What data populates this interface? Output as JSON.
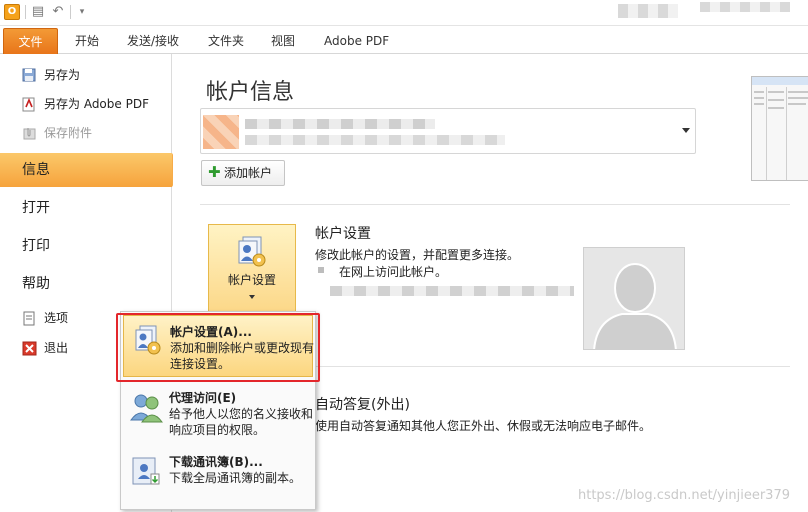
{
  "app": {
    "icon_letter": "O"
  },
  "tabs": [
    {
      "label": "文件",
      "active": true
    },
    {
      "label": "开始"
    },
    {
      "label": "发送/接收"
    },
    {
      "label": "文件夹"
    },
    {
      "label": "视图"
    },
    {
      "label": "Adobe PDF"
    }
  ],
  "nav": {
    "save_as": "另存为",
    "save_as_pdf": "另存为 Adobe PDF",
    "save_attachments": "保存附件",
    "info": "信息",
    "open": "打开",
    "print": "打印",
    "help": "帮助",
    "options": "选项",
    "exit": "退出"
  },
  "main": {
    "title": "帐户信息",
    "add_account": "添加帐户",
    "account_settings": {
      "button_label": "帐户设置",
      "title": "帐户设置",
      "desc": "修改此帐户的设置，并配置更多连接。",
      "link": "在网上访问此帐户。"
    },
    "auto_reply": {
      "title": "自动答复(外出)",
      "desc": "使用自动答复通知其他人您正外出、休假或无法响应电子邮件。"
    }
  },
  "menu": {
    "items": [
      {
        "title": "帐户设置(A)...",
        "desc": "添加和删除帐户或更改现有连接设置。",
        "highlighted": true
      },
      {
        "title": "代理访问(E)",
        "desc": "给予他人以您的名义接收和响应项目的权限。"
      },
      {
        "title": "下载通讯簿(B)...",
        "desc": "下载全局通讯簿的副本。"
      }
    ]
  },
  "watermark": "https://blog.csdn.net/yinjieer379",
  "colors": {
    "file_tab": "#e8751a",
    "active_nav": "#f6a33c",
    "highlight_box": "#e3262b"
  }
}
